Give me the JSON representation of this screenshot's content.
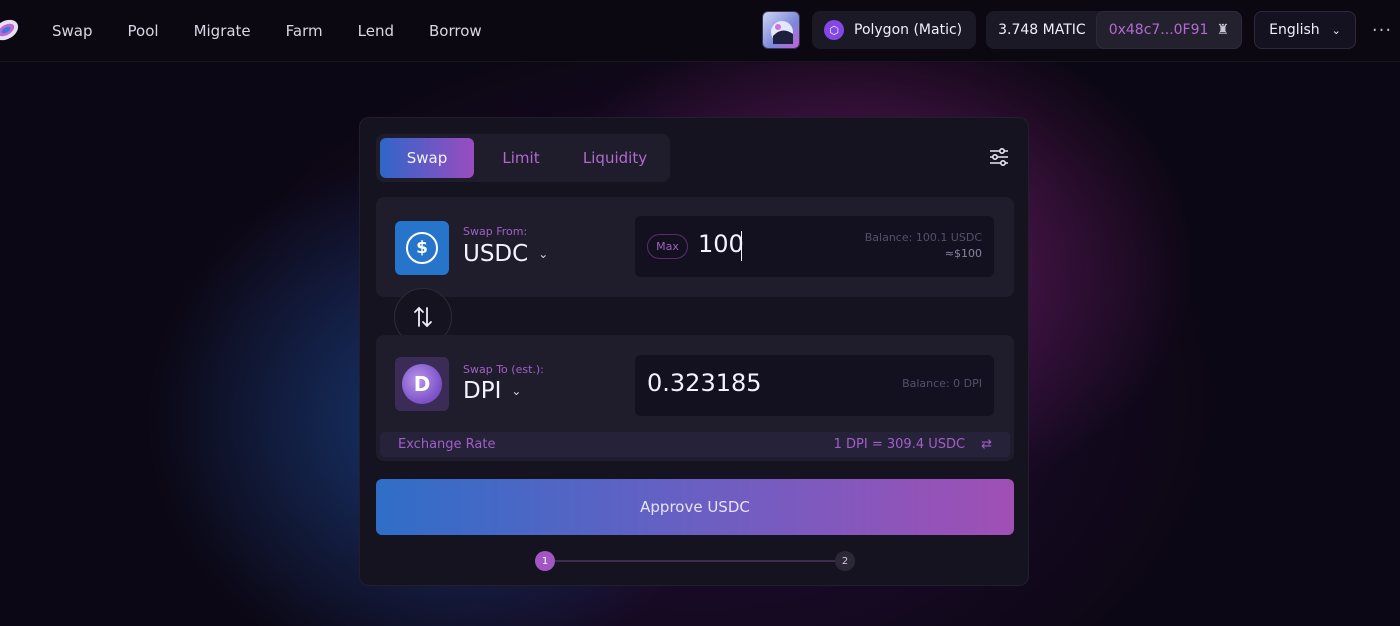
{
  "nav": {
    "items": [
      "Swap",
      "Pool",
      "Migrate",
      "Farm",
      "Lend",
      "Borrow"
    ]
  },
  "header": {
    "network": "Polygon (Matic)",
    "balance": "3.748 MATIC",
    "address": "0x48c7...0F91",
    "language": "English"
  },
  "tabs": [
    "Swap",
    "Limit",
    "Liquidity"
  ],
  "active_tab": "Swap",
  "from": {
    "label": "Swap From:",
    "token": "USDC",
    "max_label": "Max",
    "amount": "100",
    "balance": "Balance: 100.1 USDC",
    "usd_value": "≈$100"
  },
  "to": {
    "label": "Swap To (est.):",
    "token": "DPI",
    "amount": "0.323185",
    "balance": "Balance: 0 DPI"
  },
  "exchange": {
    "label": "Exchange Rate",
    "value": "1 DPI = 309.4 USDC"
  },
  "approve_label": "Approve USDC",
  "steps": [
    "1",
    "2"
  ],
  "current_step": 1,
  "colors": {
    "accent_purple": "#a25fc6",
    "accent_blue": "#2f6ec8",
    "usdc_blue": "#2775ca",
    "polygon": "#8247e5"
  },
  "icons": {
    "logo": "sushi-logo-icon",
    "settings": "sliders-icon",
    "swap_direction": "swap-arrows-icon",
    "rate_toggle": "swap-horizontal-icon"
  }
}
